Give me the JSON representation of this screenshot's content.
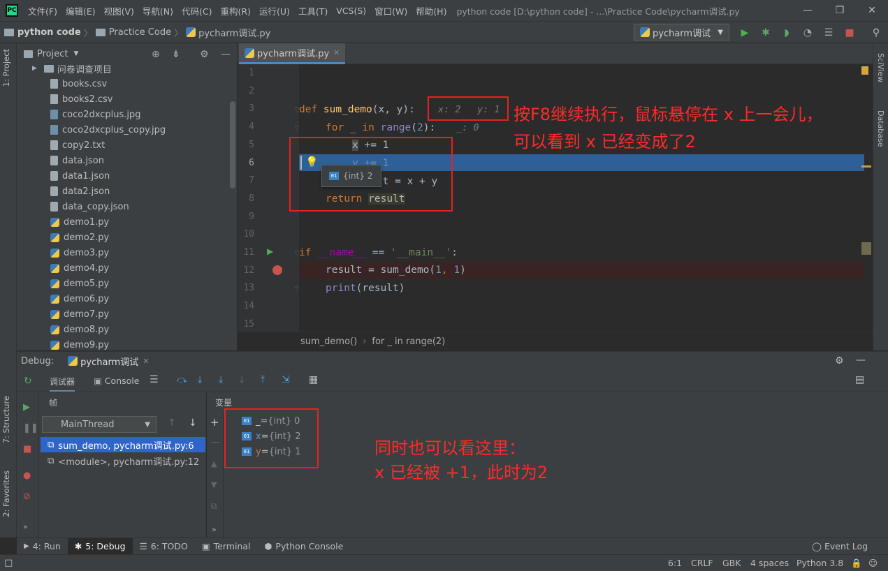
{
  "menu": {
    "items": [
      "文件(F)",
      "编辑(E)",
      "视图(V)",
      "导航(N)",
      "代码(C)",
      "重构(R)",
      "运行(U)",
      "工具(T)",
      "VCS(S)",
      "窗口(W)",
      "帮助(H)"
    ],
    "window_title": "python code [D:\\python code] - ...\\Practice Code\\pycharm调试.py"
  },
  "nav": {
    "crumb1": "python code",
    "crumb2": "Practice Code",
    "crumb3": "pycharm调试.py",
    "run_config": "pycharm调试"
  },
  "sidebar": {
    "project_tab": "1: Project",
    "structure_tab": "7: Structure",
    "favorites_tab": "2: Favorites"
  },
  "rightbar": {
    "sciview": "SciView",
    "database": "Database"
  },
  "project": {
    "title": "Project",
    "items": [
      {
        "name": "问卷调查项目",
        "type": "folder"
      },
      {
        "name": "books.csv",
        "type": "file"
      },
      {
        "name": "books2.csv",
        "type": "file"
      },
      {
        "name": "coco2dxcplus.jpg",
        "type": "img"
      },
      {
        "name": "coco2dxcplus_copy.jpg",
        "type": "img"
      },
      {
        "name": "copy2.txt",
        "type": "file"
      },
      {
        "name": "data.json",
        "type": "json"
      },
      {
        "name": "data1.json",
        "type": "json"
      },
      {
        "name": "data2.json",
        "type": "json"
      },
      {
        "name": "data_copy.json",
        "type": "json"
      },
      {
        "name": "demo1.py",
        "type": "py"
      },
      {
        "name": "demo2.py",
        "type": "py"
      },
      {
        "name": "demo3.py",
        "type": "py"
      },
      {
        "name": "demo4.py",
        "type": "py"
      },
      {
        "name": "demo5.py",
        "type": "py"
      },
      {
        "name": "demo6.py",
        "type": "py"
      },
      {
        "name": "demo7.py",
        "type": "py"
      },
      {
        "name": "demo8.py",
        "type": "py"
      },
      {
        "name": "demo9.py",
        "type": "py"
      }
    ]
  },
  "editor": {
    "tab": "pycharm调试.py",
    "line_numbers": [
      "1",
      "2",
      "3",
      "4",
      "5",
      "6",
      "7",
      "8",
      "9",
      "10",
      "11",
      "12",
      "13",
      "14",
      "15"
    ],
    "inline_x": "x: 2",
    "inline_y": "y: 1",
    "inline_underscore": "_: 0",
    "tooltip": "{int} 2",
    "tooltip_badge": "01",
    "code": {
      "l3_kw": "def ",
      "l3_fn": "sum_demo",
      "l3_rest": "(x, y):",
      "l4_kw": "for",
      "l4_mid": " _ ",
      "l4_in": "in",
      "l4_range": "range",
      "l4_open": "(",
      "l4_num": "2",
      "l4_close": "):",
      "l5_x": "x",
      "l5_rest": " += 1",
      "l6_rest": "y += 1",
      "l7_rest": "result = x + y",
      "l8_kw": "return",
      "l8_var": "result",
      "l11_kw": "if",
      "l11_name": "__name__",
      "l11_op": " == ",
      "l11_str": "'__main__'",
      "l11_colon": ":",
      "l12_a": "result = sum_demo(",
      "l12_n1": "1",
      "l12_c": ", ",
      "l12_n2": "1",
      "l12_e": ")",
      "l13_print": "print",
      "l13_rest": "(result)"
    },
    "breadcrumb1": "sum_demo()",
    "breadcrumb2": "for _ in range(2)"
  },
  "debug": {
    "label": "Debug:",
    "tab": "pycharm调试",
    "debugger_tab": "调试器",
    "console_tab": "Console",
    "frames_label": "帧",
    "vars_label": "变量",
    "thread": "MainThread",
    "frames": [
      "sum_demo, pycharm调试.py:6",
      "<module>, pycharm调试.py:12"
    ],
    "vars": [
      {
        "name": "_",
        "value": "{int} 0"
      },
      {
        "name": "x",
        "value": "{int} 2"
      },
      {
        "name": "y",
        "value": "{int} 1"
      }
    ],
    "eq": " = ",
    "badge": "01"
  },
  "bottom_tabs": {
    "run": "4: Run",
    "debug": "5: Debug",
    "todo": "6: TODO",
    "terminal": "Terminal",
    "pyconsole": "Python Console",
    "eventlog": "Event Log"
  },
  "status": {
    "pos": "6:1",
    "crlf": "CRLF",
    "enc": "GBK",
    "indent": "4 spaces",
    "python": "Python 3.8"
  },
  "annotations": {
    "top_line1": "按F8继续执行，鼠标悬停在 x 上一会儿，",
    "top_line2": "可以看到 x 已经变成了2",
    "bottom_line1": "同时也可以看这里：",
    "bottom_line2": "x 已经被 +1，此时为2",
    "color": "#ff2a2a"
  }
}
